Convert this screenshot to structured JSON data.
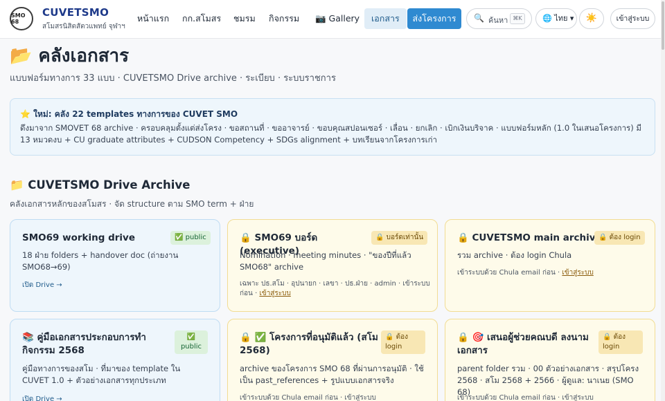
{
  "header": {
    "logo_text": "SMO 68",
    "brand_title": "CUVETSMO",
    "brand_sub": "สโมสรนิสิตสัตวแพทย์ จุฬาฯ",
    "nav": [
      "หน้าแรก",
      "กก.สโมสร",
      "ชมรม",
      "กิจกรรม",
      "📷 Gallery",
      "เอกสาร"
    ],
    "cta": "ส่งโครงการ",
    "search_placeholder": "ค้นหา",
    "search_kbd": "⌘K",
    "lang": "🌐 ไทย ▾",
    "theme_icon": "☀️",
    "login": "เข้าสู่ระบบ"
  },
  "page": {
    "title": "📂 คลังเอกสาร",
    "subtitle": "แบบฟอร์มทางการ 33 แบบ · CUVETSMO Drive archive · ระเบียบ · ระบบราชการ"
  },
  "notice": {
    "title": "⭐ ใหม่: คลัง 22 templates ทางการของ CUVET SMO",
    "body": "ดึงมาจาก SMOVET 68 archive · ครอบคลุมตั้งแต่ส่งโครง · ขอสถานที่ · ขออาจารย์ · ขอบคุณสปอนเซอร์ · เลื่อน · ยกเลิก · เบิกเงินบริจาค · แบบฟอร์มหลัก (1.0 ในเสนอโครงการ) มี 13 หมวดงบ + CU graduate attributes + CUDSON Competency + SDGs alignment + บทเรียนจากโครงการเก่า"
  },
  "section": {
    "title": "📁 CUVETSMO Drive Archive",
    "subtitle": "คลังเอกสารหลักของสโมสร · จัด structure ตาม SMO term + ฝ่าย"
  },
  "cards": [
    {
      "title": "SMO69 working drive",
      "badge": "✅ public",
      "desc": "18 ฝ่าย folders + handover doc (ถ่ายงาน SMO68→69)",
      "link": "เปิด Drive →"
    },
    {
      "title": "🔒 SMO69 บอร์ด (executive)",
      "badge": "🔒 บอร์ดเท่านั้น",
      "desc": "Nomination · meeting minutes · \"ของปีที่แล้ว SMO68\" archive",
      "note": "เฉพาะ ปธ.สโม · อุปนายก · เลขา · ปธ.ฝ่าย · admin · เข้าระบบก่อน · ",
      "note_link": "เข้าสู่ระบบ"
    },
    {
      "title": "🔒 CUVETSMO main archive",
      "badge": "🔒 ต้อง login",
      "desc": "รวม archive · ต้อง login Chula",
      "note": "เข้าระบบด้วย Chula email ก่อน · ",
      "note_link": "เข้าสู่ระบบ"
    },
    {
      "title": "📚 คู่มือเอกสารประกอบการทำกิจกรรม 2568",
      "badge": "✅ public",
      "desc": "คู่มือทางการของสโม · ที่มาของ template ใน CUVET 1.0 + ตัวอย่างเอกสารทุกประเภท",
      "link": "เปิด Drive →"
    },
    {
      "title": "🔒 ✅ โครงการที่อนุมัติแล้ว (สโม 2568)",
      "badge": "🔒 ต้อง login",
      "desc": "archive ของโครงการ SMO 68 ที่ผ่านการอนุมัติ · ใช้เป็น past_references + รูปแบบเอกสารจริง",
      "note": "เข้าระบบด้วย Chula email ก่อน · ",
      "note_link": "เข้าสู่ระบบ"
    },
    {
      "title": "🔒 🎯 เสนอผู้ช่วยคณบดี ลงนามเอกสาร",
      "badge": "🔒 ต้อง login",
      "desc": "parent folder รวม · 00 ตัวอย่างเอกสาร · สรุปโครง 2568 · สโม 2568 + 2566 · ผู้ดูแล: นาเนย (SMO 68)",
      "note": "เข้าระบบด้วย Chula email ก่อน · ",
      "note_link": "เข้าสู่ระบบ"
    }
  ]
}
